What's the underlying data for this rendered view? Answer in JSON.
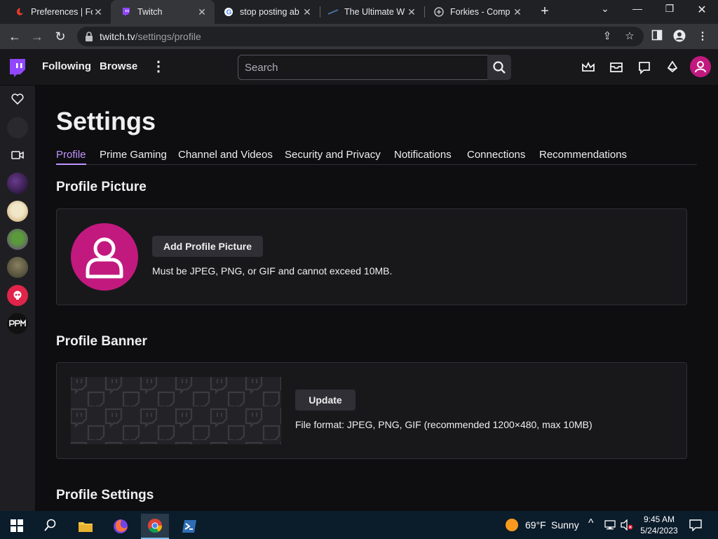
{
  "browser": {
    "tabs": [
      {
        "title": "Preferences | Fo",
        "active": false
      },
      {
        "title": "Twitch",
        "active": true
      },
      {
        "title": "stop posting ab",
        "active": false
      },
      {
        "title": "The Ultimate W",
        "active": false
      },
      {
        "title": "Forkies - Comp",
        "active": false
      }
    ],
    "url_host": "twitch.tv",
    "url_path": "/settings/profile"
  },
  "topnav": {
    "following": "Following",
    "browse": "Browse",
    "search_placeholder": "Search"
  },
  "settings": {
    "title": "Settings",
    "tabs": [
      "Profile",
      "Prime Gaming",
      "Channel and Videos",
      "Security and Privacy",
      "Notifications",
      "Connections",
      "Recommendations"
    ],
    "active_tab": "Profile",
    "profile_picture": {
      "heading": "Profile Picture",
      "button": "Add Profile Picture",
      "hint": "Must be JPEG, PNG, or GIF and cannot exceed 10MB."
    },
    "profile_banner": {
      "heading": "Profile Banner",
      "button": "Update",
      "hint": "File format: JPEG, PNG, GIF (recommended 1200×480, max 10MB)"
    },
    "profile_settings": {
      "heading": "Profile Settings"
    }
  },
  "taskbar": {
    "weather_temp": "69°F",
    "weather_cond": "Sunny",
    "time": "9:45 AM",
    "date": "5/24/2023"
  },
  "colors": {
    "twitch_purple": "#9147ff",
    "accent_tab": "#bf94ff",
    "avatar_pink": "#c2197f"
  }
}
